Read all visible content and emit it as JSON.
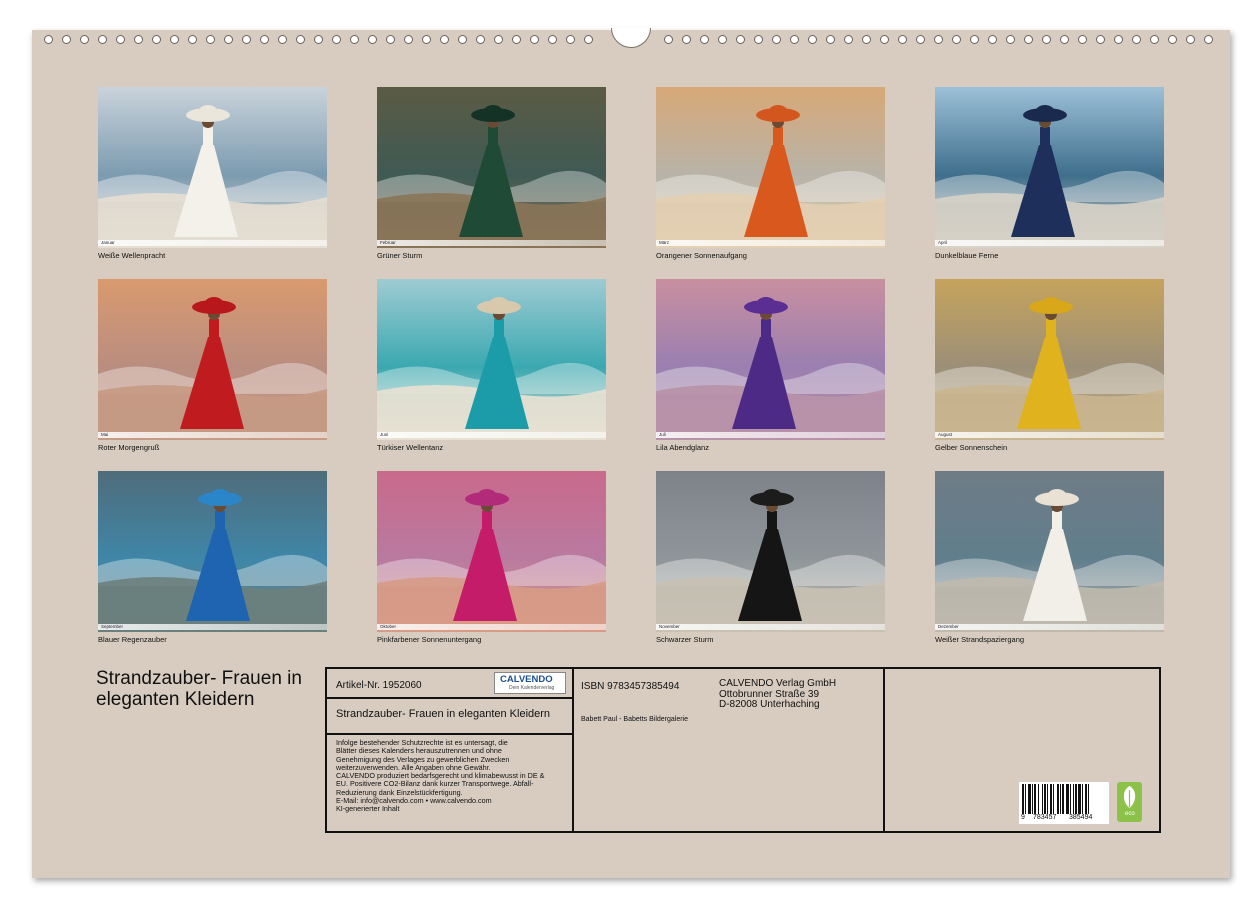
{
  "thumbnails": [
    {
      "caption": "Weiße Wellenpracht",
      "month": "Januar",
      "palette": {
        "sky": "#c9d3db",
        "sea": "#7c9bb0",
        "sand": "#e6ded2",
        "dress": "#f4f1ea",
        "hat": "#ebe6dc"
      }
    },
    {
      "caption": "Grüner Sturm",
      "month": "Februar",
      "palette": {
        "sky": "#5b5b44",
        "sea": "#3f5a54",
        "sand": "#8a7458",
        "dress": "#1f4a35",
        "hat": "#143226"
      }
    },
    {
      "caption": "Orangener Sonnenaufgang",
      "month": "März",
      "palette": {
        "sky": "#d8a877",
        "sea": "#b7b3a8",
        "sand": "#e3cfb2",
        "dress": "#d9581e",
        "hat": "#d3561f"
      }
    },
    {
      "caption": "Dunkelblaue Ferne",
      "month": "April",
      "palette": {
        "sky": "#9cc0d8",
        "sea": "#3f6f8c",
        "sand": "#d7d1c6",
        "dress": "#1d2f5a",
        "hat": "#1a2a4e"
      }
    },
    {
      "caption": "Roter Morgengruß",
      "month": "Mai",
      "palette": {
        "sky": "#d99a6e",
        "sea": "#b98d80",
        "sand": "#c59a84",
        "dress": "#c01c20",
        "hat": "#b8181c"
      }
    },
    {
      "caption": "Türkiser Wellentanz",
      "month": "Juni",
      "palette": {
        "sky": "#9fcbd3",
        "sea": "#3aa8b0",
        "sand": "#e8e1d3",
        "dress": "#1b9ca8",
        "hat": "#d8c9ad"
      }
    },
    {
      "caption": "Lila Abendglanz",
      "month": "Juli",
      "palette": {
        "sky": "#c98fa0",
        "sea": "#9a7fb0",
        "sand": "#b892a8",
        "dress": "#4d2a86",
        "hat": "#5a2e92"
      }
    },
    {
      "caption": "Gelber Sonnenschein",
      "month": "August",
      "palette": {
        "sky": "#c5a35c",
        "sea": "#9c8f78",
        "sand": "#c9b58f",
        "dress": "#e0b21e",
        "hat": "#d8a71a"
      }
    },
    {
      "caption": "Blauer Regenzauber",
      "month": "September",
      "palette": {
        "sky": "#4f6c7a",
        "sea": "#3f86a8",
        "sand": "#6b7f7c",
        "dress": "#1f64b0",
        "hat": "#2b86c9"
      }
    },
    {
      "caption": "Pinkfarbener Sonnenuntergang",
      "month": "Oktober",
      "palette": {
        "sky": "#c96a8b",
        "sea": "#b97aa0",
        "sand": "#d79b86",
        "dress": "#c41c69",
        "hat": "#b22a7a"
      }
    },
    {
      "caption": "Schwarzer Sturm",
      "month": "November",
      "palette": {
        "sky": "#7d8288",
        "sea": "#8f969a",
        "sand": "#c8c1b4",
        "dress": "#151515",
        "hat": "#1c1c1c"
      }
    },
    {
      "caption": "Weißer Strandspaziergang",
      "month": "Dezember",
      "palette": {
        "sky": "#6f7c86",
        "sea": "#607e8c",
        "sand": "#bfb9ae",
        "dress": "#f2efe8",
        "hat": "#e9e2d4"
      }
    }
  ],
  "title": "Strandzauber- Frauen in eleganten Kleidern",
  "info": {
    "article": "Artikel-Nr. 1952060",
    "logo_text": "CALVENDO",
    "logo_sub": "Dein Kalenderverlag",
    "subtitle": "Strandzauber- Frauen in eleganten Kleidern",
    "legal": [
      "Infolge bestehender Schutzrechte ist es untersagt, die",
      "Blätter dieses Kalenders herauszutrennen und ohne",
      "Genehmigung des Verlages zu gewerblichen Zwecken",
      "weiterzuverwenden. Alle Angaben ohne Gewähr.",
      "CALVENDO produziert bedarfsgerecht und klimabewusst in DE &",
      "EU. Positivere CO2-Bilanz dank kurzer Transportwege. Abfall-",
      "Reduzierung dank Einzelstückfertigung.",
      "E-Mail: info@calvendo.com • www.calvendo.com",
      "KI-generierter Inhalt"
    ],
    "isbn": "ISBN 9783457385494",
    "author": "Babett Paul - Babetts Bildergalerie",
    "publisher": [
      "CALVENDO Verlag GmbH",
      "Ottobrunner Straße 39",
      "D-82008 Unterhaching"
    ],
    "barcode_left": "9",
    "barcode_mid": "783457",
    "barcode_right": "385494",
    "eco_label": "eco"
  }
}
